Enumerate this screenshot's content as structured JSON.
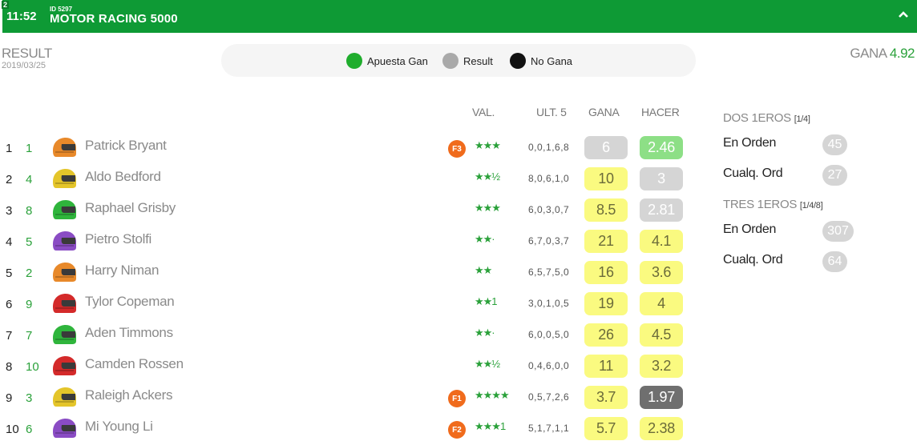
{
  "header": {
    "badge": "2",
    "time": "11:52",
    "event_id": "ID 5297",
    "title": "MOTOR RACING 5000"
  },
  "result": {
    "label": "RESULT",
    "date": "2019/03/25"
  },
  "legend": [
    {
      "label": "Apuesta Gan",
      "color": "#1fad2d"
    },
    {
      "label": "Result",
      "color": "#a9a9a9"
    },
    {
      "label": "No Gana",
      "color": "#111111"
    }
  ],
  "gana_top": {
    "label": "GANA",
    "value": "4.92"
  },
  "columns": {
    "val": "VAL.",
    "ult5": "ULT. 5",
    "gana": "GANA",
    "hacer": "HACER"
  },
  "rows": [
    {
      "pos": "1",
      "num": "1",
      "name": "Patrick Bryant",
      "helmet": "#e8892a",
      "badge": "F3",
      "stars": "★★★",
      "ult": "0,0,1,6,8",
      "gana": "6",
      "gana_style": "gray",
      "hacer": "2.46",
      "hacer_style": "green"
    },
    {
      "pos": "2",
      "num": "4",
      "name": "Aldo Bedford",
      "helmet": "#e4c52a",
      "badge": "",
      "stars": "★★½",
      "ult": "8,0,6,1,0",
      "gana": "10",
      "gana_style": "yellow",
      "hacer": "3",
      "hacer_style": "gray"
    },
    {
      "pos": "3",
      "num": "8",
      "name": "Raphael Grisby",
      "helmet": "#2fb53c",
      "badge": "",
      "stars": "★★★",
      "ult": "6,0,3,0,7",
      "gana": "8.5",
      "gana_style": "yellow",
      "hacer": "2.81",
      "hacer_style": "gray"
    },
    {
      "pos": "4",
      "num": "5",
      "name": "Pietro Stolfi",
      "helmet": "#8a4cc4",
      "badge": "",
      "stars": "★★·",
      "ult": "6,7,0,3,7",
      "gana": "21",
      "gana_style": "yellow",
      "hacer": "4.1",
      "hacer_style": "yellow"
    },
    {
      "pos": "5",
      "num": "2",
      "name": "Harry Niman",
      "helmet": "#e8892a",
      "badge": "",
      "stars": "★★",
      "ult": "6,5,7,5,0",
      "gana": "16",
      "gana_style": "yellow",
      "hacer": "3.6",
      "hacer_style": "yellow"
    },
    {
      "pos": "6",
      "num": "9",
      "name": "Tylor Copeman",
      "helmet": "#d42a2a",
      "badge": "",
      "stars": "★★1",
      "ult": "3,0,1,0,5",
      "gana": "19",
      "gana_style": "yellow",
      "hacer": "4",
      "hacer_style": "yellow"
    },
    {
      "pos": "7",
      "num": "7",
      "name": "Aden Timmons",
      "helmet": "#2fb53c",
      "badge": "",
      "stars": "★★·",
      "ult": "6,0,0,5,0",
      "gana": "26",
      "gana_style": "yellow",
      "hacer": "4.5",
      "hacer_style": "yellow"
    },
    {
      "pos": "8",
      "num": "10",
      "name": "Camden Rossen",
      "helmet": "#d42a2a",
      "badge": "",
      "stars": "★★½",
      "ult": "0,4,6,0,0",
      "gana": "11",
      "gana_style": "yellow",
      "hacer": "3.2",
      "hacer_style": "yellow"
    },
    {
      "pos": "9",
      "num": "3",
      "name": "Raleigh Ackers",
      "helmet": "#e4c52a",
      "badge": "F1",
      "stars": "★★★★",
      "ult": "0,5,7,2,6",
      "gana": "3.7",
      "gana_style": "yellow",
      "hacer": "1.97",
      "hacer_style": "dark"
    },
    {
      "pos": "10",
      "num": "6",
      "name": "Mi Young Li",
      "helmet": "#8a4cc4",
      "badge": "F2",
      "stars": "★★★1",
      "ult": "5,1,7,1,1",
      "gana": "5.7",
      "gana_style": "yellow",
      "hacer": "2.38",
      "hacer_style": "yellow"
    }
  ],
  "side": {
    "dos_title": "DOS 1EROS",
    "dos_note": "[1/4]",
    "dos_orden_label": "En Orden",
    "dos_orden_value": "45",
    "dos_cualq_label": "Cualq. Ord",
    "dos_cualq_value": "27",
    "tres_title": "TRES 1EROS",
    "tres_note": "[1/4/8]",
    "tres_orden_label": "En Orden",
    "tres_orden_value": "307",
    "tres_cualq_label": "Cualq. Ord",
    "tres_cualq_value": "64"
  }
}
